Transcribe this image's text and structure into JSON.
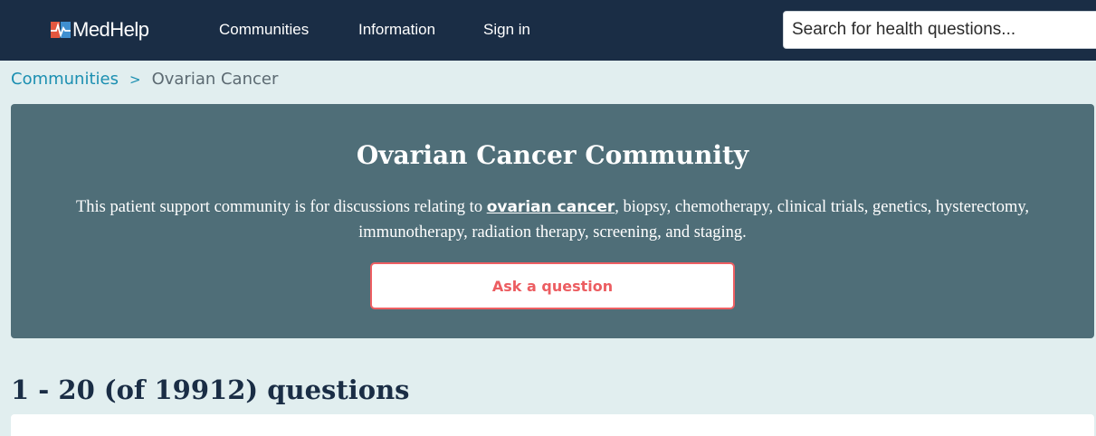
{
  "header": {
    "logo_text": "MedHelp",
    "logo_icon": "medhelp-heartbeat-icon",
    "nav": [
      "Communities",
      "Information",
      "Sign in"
    ],
    "search_placeholder": "Search for health questions..."
  },
  "breadcrumb": {
    "parent": "Communities",
    "separator": ">",
    "current": "Ovarian Cancer"
  },
  "hero": {
    "title": "Ovarian Cancer Community",
    "description_before": "This patient support community is for discussions relating to ",
    "description_link": "ovarian cancer",
    "description_after": ", biopsy, chemotherapy, clinical trials, genetics, hysterectomy, immunotherapy, radiation therapy, screening, and staging.",
    "ask_button": "Ask a question"
  },
  "questions": {
    "count_label": "1 - 20 (of 19912) questions"
  },
  "colors": {
    "nav_background": "#1a2d45",
    "page_background": "#e1eeef",
    "hero_background": "#4f6e78",
    "accent_red": "#ec5d61",
    "link_blue": "#1b8fb1"
  }
}
